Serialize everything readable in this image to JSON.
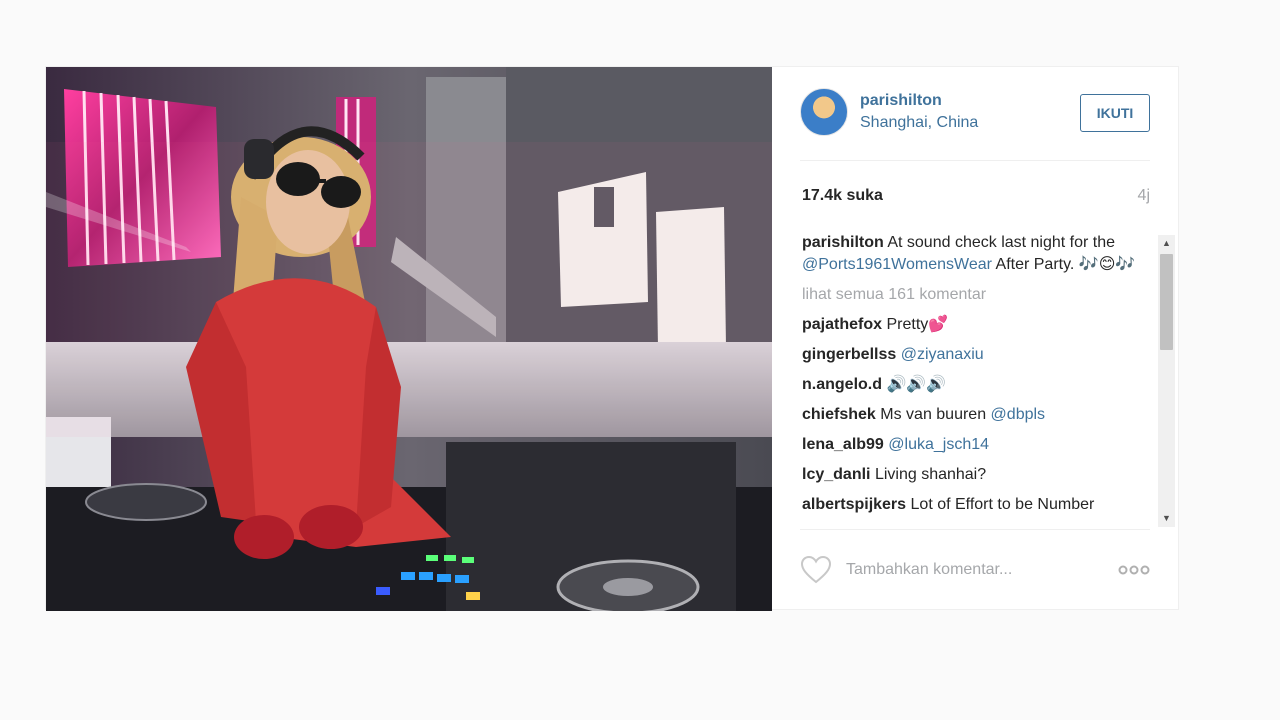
{
  "post": {
    "photo_alt": "",
    "header": {
      "username": "parishilton",
      "location": "Shanghai, China",
      "follow_label": "IKUTI"
    },
    "likes": "17.4k suka",
    "time": "4j",
    "caption": {
      "user": "parishilton",
      "text_before": "At sound check last night for the ",
      "mention": "@Ports1961WomensWear",
      "text_after": " After Party. 🎶😊🎶"
    },
    "see_all_comments": "lihat semua 161 komentar",
    "comments": [
      {
        "user": "pajathefox",
        "text": "Pretty💕",
        "mention": ""
      },
      {
        "user": "gingerbellss",
        "text": "",
        "mention": "@ziyanaxiu"
      },
      {
        "user": "n.angelo.d",
        "text": "🔊🔊🔊",
        "mention": ""
      },
      {
        "user": "chiefshek",
        "text": "Ms van buuren ",
        "mention": "@dbpls"
      },
      {
        "user": "lena_alb99",
        "text": "",
        "mention": "@luka_jsch14"
      },
      {
        "user": "lcy_danli",
        "text": "Living shanhai?",
        "mention": ""
      },
      {
        "user": "albertspijkers",
        "text": "Lot of Effort to be Number",
        "mention": ""
      }
    ],
    "add_comment_placeholder": "Tambahkan komentar...",
    "icons": {
      "like": "heart-icon",
      "more": "more-options-icon",
      "scroll_up": "scroll-up-arrow-icon",
      "scroll_down": "scroll-down-arrow-icon"
    },
    "colors": {
      "link": "#3f729b",
      "muted": "#a5a7aa",
      "text": "#262626"
    }
  }
}
